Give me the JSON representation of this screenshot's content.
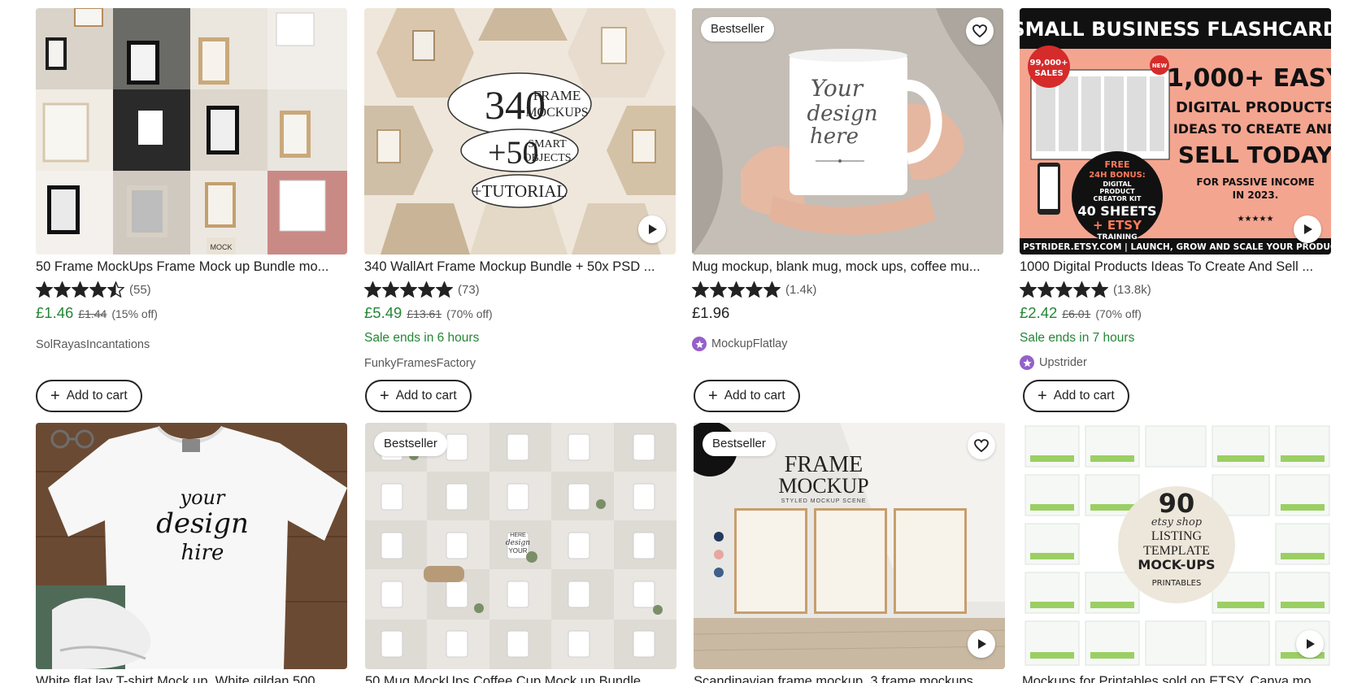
{
  "listings": [
    {
      "title": "50 Frame MockUps Frame Mock up Bundle mo...",
      "rating_stars": 4.5,
      "review_count": "(55)",
      "price": "£1.46",
      "original_price": "£1.44",
      "discount": "(15% off)",
      "sale_text": "",
      "shop": "SolRayasIncantations",
      "star_seller": false,
      "badge": "",
      "favorite": false,
      "video": false,
      "cart_label": "Add to cart",
      "image_text": [
        "MOCK"
      ]
    },
    {
      "title": "340 WallArt Frame Mockup Bundle + 50x PSD ...",
      "rating_stars": 5,
      "review_count": "(73)",
      "price": "£5.49",
      "original_price": "£13.61",
      "discount": "(70% off)",
      "sale_text": "Sale ends in 6 hours",
      "shop": "FunkyFramesFactory",
      "star_seller": false,
      "badge": "",
      "favorite": false,
      "video": true,
      "cart_label": "Add to cart",
      "image_text": [
        "340",
        "FRAME",
        "MOCKUPS",
        "+50",
        "SMART",
        "OBJECTS",
        "+TUTORIAL"
      ]
    },
    {
      "title": "Mug mockup, blank mug, mock ups, coffee mu...",
      "rating_stars": 5,
      "review_count": "(1.4k)",
      "price": "£1.96",
      "original_price": "",
      "discount": "",
      "sale_text": "",
      "shop": "MockupFlatlay",
      "star_seller": true,
      "badge": "Bestseller",
      "favorite": true,
      "video": false,
      "cart_label": "Add to cart",
      "image_text": [
        "Your",
        "design",
        "here"
      ]
    },
    {
      "title": "1000 Digital Products Ideas To Create And Sell ...",
      "rating_stars": 5,
      "review_count": "(13.8k)",
      "price": "£2.42",
      "original_price": "£6.01",
      "discount": "(70% off)",
      "sale_text": "Sale ends in 7 hours",
      "shop": "Upstrider",
      "star_seller": true,
      "badge": "",
      "favorite": false,
      "video": true,
      "cart_label": "Add to cart",
      "image_text": [
        "SMALL BUSINESS FLASHCARD",
        "99,000+",
        "SALES",
        "NEW",
        "1,000+ EASY",
        "DIGITAL PRODUCTS",
        "IDEAS TO CREATE AND",
        "SELL TODAY",
        "FOR PASSIVE INCOME",
        "IN 2023.",
        "FREE",
        "24H BONUS:",
        "DIGITAL",
        "PRODUCT",
        "CREATOR KIT",
        "40 SHEETS",
        "+ ETSY",
        "TRAINING",
        "PSTRIDER.ETSY.COM | LAUNCH, GROW AND SCALE YOUR PRODUCT-BASED"
      ]
    },
    {
      "title": "White flat lay T-shirt Mock up, White gildan 500...",
      "badge": "",
      "favorite": false,
      "video": false,
      "image_text": [
        "your",
        "design",
        "hire"
      ]
    },
    {
      "title": "50 Mug MockUps Coffee Cup Mock up Bundle...",
      "badge": "Bestseller",
      "favorite": false,
      "video": false,
      "image_text": [
        "YOUR",
        "design",
        "HERE"
      ]
    },
    {
      "title": "Scandinavian frame mockup, 3 frame mockups...",
      "badge": "Bestseller",
      "favorite": true,
      "video": true,
      "image_text": [
        "FRAME",
        "MOCKUP",
        "STYLED MOCKUP SCENE"
      ]
    },
    {
      "title": "Mockups for Printables sold on ETSY, Canva mo...",
      "badge": "",
      "favorite": false,
      "video": true,
      "image_text": [
        "90",
        "etsy shop",
        "LISTING",
        "TEMPLATE",
        "MOCK-UPS",
        "PRINTABLES"
      ]
    }
  ],
  "colors": {
    "sale_green": "#258635",
    "star_seller_purple": "#9560c8",
    "text_primary": "#222222",
    "text_secondary": "#595959"
  }
}
